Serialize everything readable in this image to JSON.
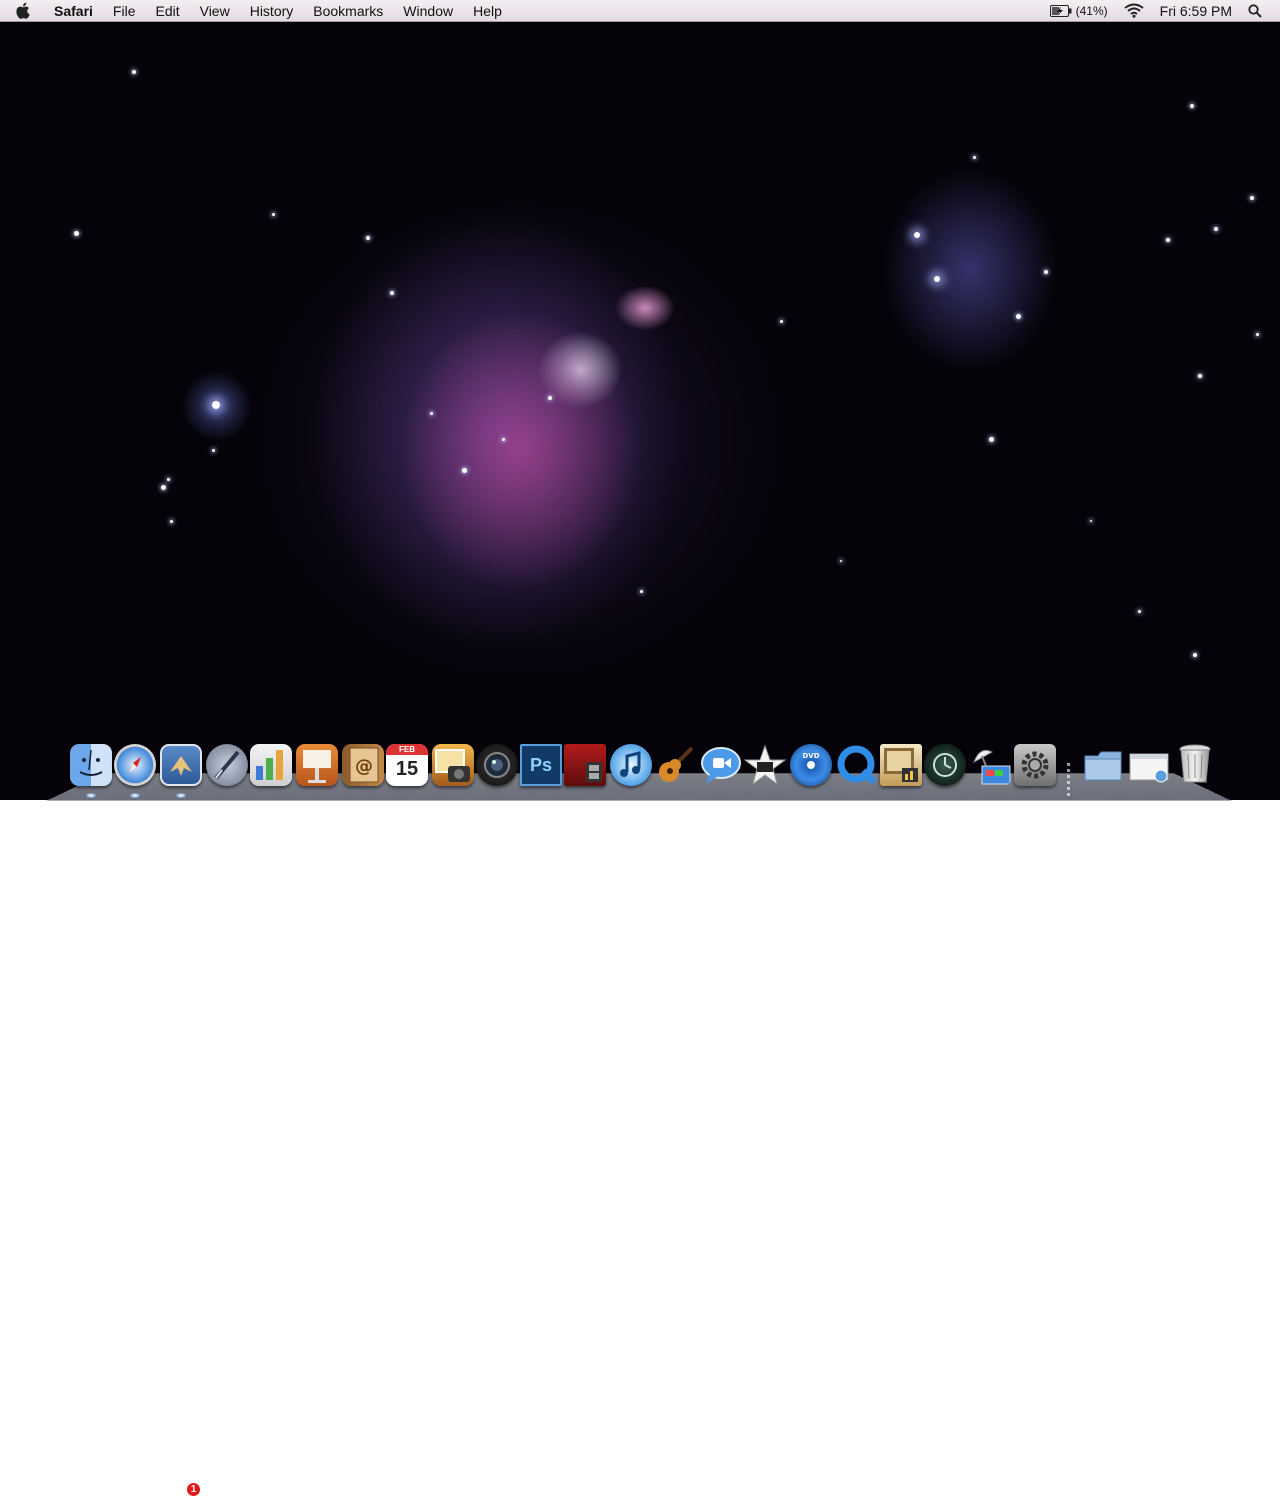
{
  "menubar": {
    "app_name": "Safari",
    "menus": [
      "File",
      "Edit",
      "View",
      "History",
      "Bookmarks",
      "Window",
      "Help"
    ],
    "battery_percent": "(41%)",
    "clock": "Fri 6:59 PM"
  },
  "dock": {
    "mail_badge": "1",
    "photoshop_label": "Ps",
    "ical_day": "15",
    "ical_month": "FEB",
    "apps": [
      "Finder",
      "Safari",
      "Mail",
      "Pages",
      "Keynote",
      "Address Book",
      "iCal",
      "iPhoto",
      "Photo Booth",
      "Photoshop",
      "Movie",
      "iTunes",
      "GarageBand",
      "iChat",
      "iMovie",
      "DVD Player",
      "QuickTime",
      "Preview",
      "Time Machine",
      "Network Utility",
      "System Preferences",
      "Documents",
      "Downloads",
      "Trash"
    ]
  }
}
